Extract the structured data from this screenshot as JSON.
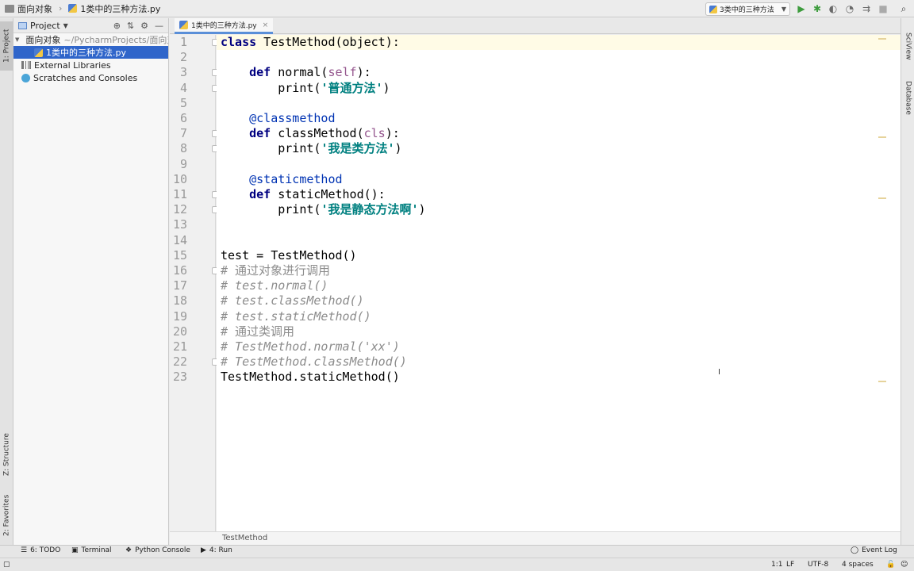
{
  "nav": {
    "project_name": "面向对象",
    "file_name": "1类中的三种方法.py"
  },
  "toolbar": {
    "run_config": "3类中的三种方法"
  },
  "left_strip": {
    "project_tab": "1: Project",
    "structure_tab": "Z: Structure",
    "favorites_tab": "2: Favorites"
  },
  "right_strip": {
    "sciview_tab": "SciView",
    "database_tab": "Database"
  },
  "project_panel": {
    "title": "Project",
    "root_name": "面向对象",
    "root_path": "~/PycharmProjects/面向对",
    "selected_file": "1类中的三种方法.py",
    "external_libraries": "External Libraries",
    "scratches": "Scratches and Consoles"
  },
  "editor": {
    "tab_label": "1类中的三种方法.py",
    "breadcrumb": "TestMethod",
    "line_numbers": [
      "1",
      "2",
      "3",
      "4",
      "5",
      "6",
      "7",
      "8",
      "9",
      "10",
      "11",
      "12",
      "13",
      "14",
      "15",
      "16",
      "17",
      "18",
      "19",
      "20",
      "21",
      "22",
      "23"
    ],
    "code": {
      "l1_kw": "class",
      "l1_rest": " TestMethod(object):",
      "l3_kw": "def",
      "l3_name": " normal(",
      "l3_self": "self",
      "l3_end": "):",
      "l4_fn": "print(",
      "l4_str": "'普通方法'",
      "l4_end": ")",
      "l6_deco": "@classmethod",
      "l7_kw": "def",
      "l7_name": " classMethod(",
      "l7_cls": "cls",
      "l7_end": "):",
      "l8_fn": "print(",
      "l8_str": "'我是类方法'",
      "l8_end": ")",
      "l10_deco": "@staticmethod",
      "l11_kw": "def",
      "l11_name": " staticMethod():",
      "l12_fn": "print(",
      "l12_str": "'我是静态方法啊'",
      "l12_end": ")",
      "l15": "test = TestMethod()",
      "l16": "# 通过对象进行调用",
      "l17": "# test.normal()",
      "l18": "# test.classMethod()",
      "l19": "# test.staticMethod()",
      "l20": "# 通过类调用",
      "l21": "# TestMethod.normal('xx')",
      "l22": "# TestMethod.classMethod()",
      "l23": "TestMethod.staticMethod()"
    }
  },
  "bottom_bar": {
    "todo": "6: TODO",
    "terminal": "Terminal",
    "python_console": "Python Console",
    "run": "4: Run",
    "event_log": "Event Log"
  },
  "status": {
    "position": "1:1",
    "line_sep": "LF",
    "encoding": "UTF-8",
    "indent": "4 spaces"
  }
}
